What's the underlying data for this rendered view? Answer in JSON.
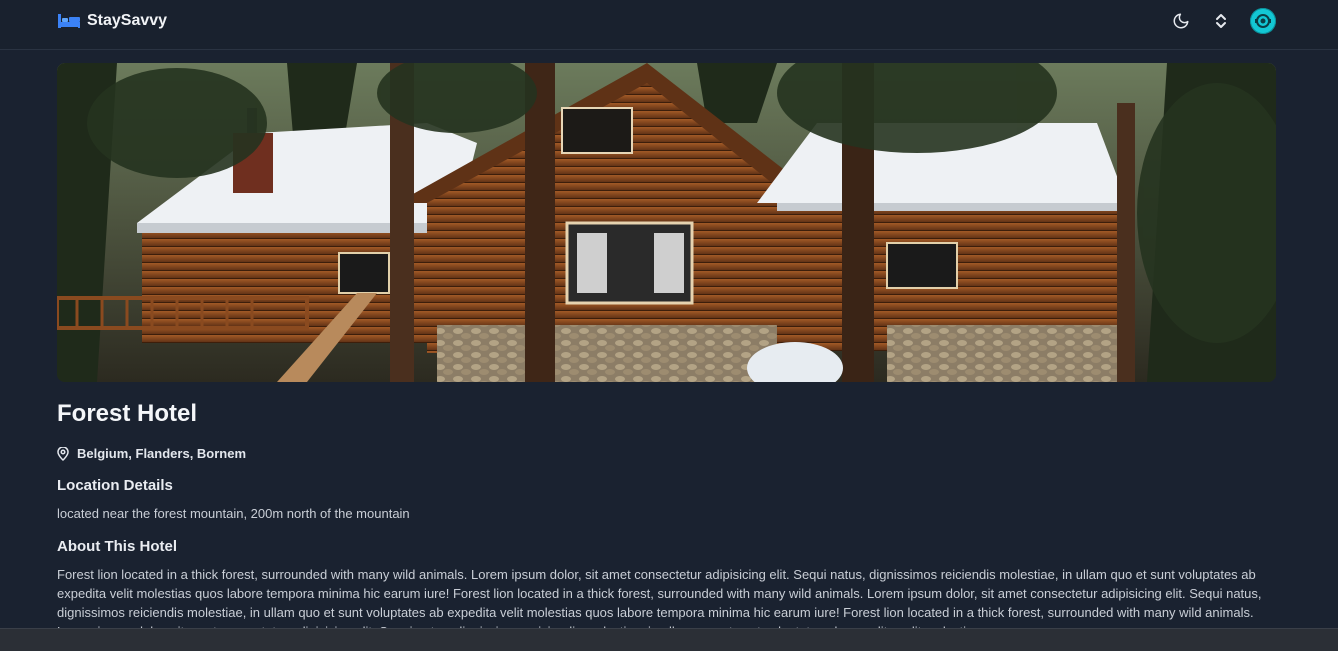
{
  "brand": {
    "name": "StaySavvy"
  },
  "header": {
    "icons": [
      "moon-icon",
      "chevron-up-down-icon",
      "avatar-icon"
    ]
  },
  "hotel": {
    "name": "Forest Hotel",
    "location": "Belgium, Flanders, Bornem",
    "location_details_heading": "Location Details",
    "location_details": "located near the forest mountain, 200m north of the mountain",
    "about_heading": "About This Hotel",
    "about": "Forest lion located in a thick forest, surrounded with many wild animals. Lorem ipsum dolor, sit amet consectetur adipisicing elit. Sequi natus, dignissimos reiciendis molestiae, in ullam quo et sunt voluptates ab expedita velit molestias quos labore tempora minima hic earum iure! Forest lion located in a thick forest, surrounded with many wild animals. Lorem ipsum dolor, sit amet consectetur adipisicing elit. Sequi natus, dignissimos reiciendis molestiae, in ullam quo et sunt voluptates ab expedita velit molestias quos labore tempora minima hic earum iure! Forest lion located in a thick forest, surrounded with many wild animals. Lorem ipsum dolor, sit amet consectetur adipisicing elit. Sequi natus, dignissimos reiciendis molestiae, in ullam quo et sunt voluptates ab expedita velit molestias quos"
  },
  "colors": {
    "background": "#1a2230",
    "accent": "#13c7d4",
    "brand_icon": "#3b82f6"
  }
}
